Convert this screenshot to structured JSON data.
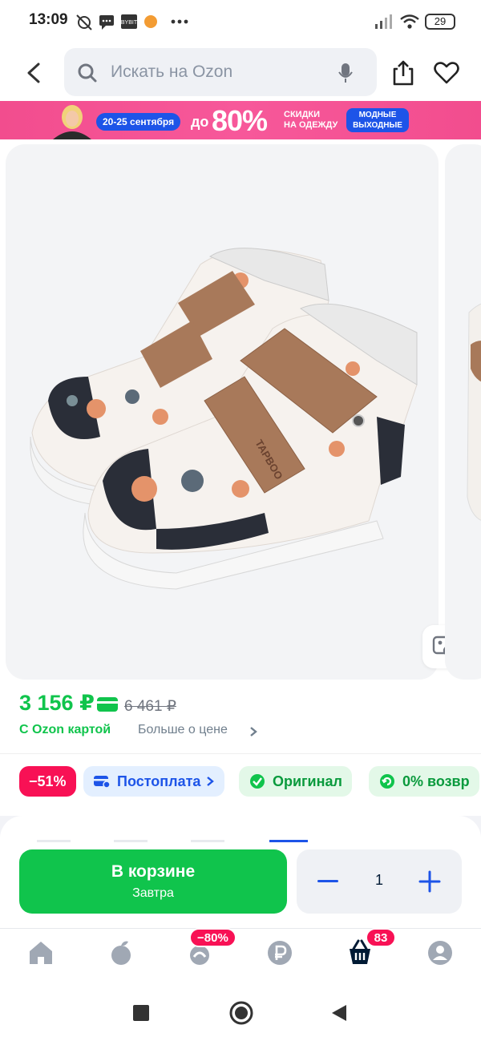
{
  "status_bar": {
    "time": "13:09",
    "battery": "29"
  },
  "header": {
    "search_placeholder": "Искать на Ozon"
  },
  "banner": {
    "dates": "20-25 сентября",
    "discount_prefix": "до",
    "discount": "80%",
    "text_line1": "СКИДКИ",
    "text_line2": "НА ОДЕЖДУ",
    "badge_line1": "МОДНЫЕ",
    "badge_line2": "ВЫХОДНЫЕ"
  },
  "product": {
    "brand_on_strap": "TAPBOO"
  },
  "price": {
    "current": "3 156 ₽",
    "old": "6 461 ₽",
    "card_label": "С Ozon картой",
    "more_label": "Больше о цене"
  },
  "badges": {
    "discount": "−51%",
    "postpay": "Постоплата",
    "original": "Оригинал",
    "return": "0% возвр"
  },
  "cart": {
    "button_title": "В корзине",
    "button_sub": "Завтра",
    "quantity": "1"
  },
  "tabbar": {
    "promo_badge": "−80%",
    "cart_badge": "83"
  },
  "colors": {
    "accent_blue": "#1d54e8",
    "green": "#10c44c",
    "pink": "#f81155"
  }
}
